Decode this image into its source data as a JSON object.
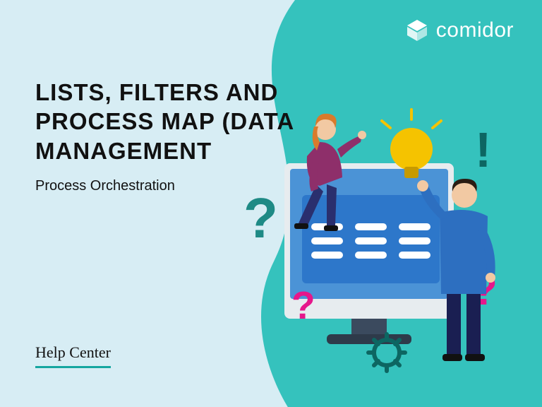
{
  "brand": {
    "name": "comidor"
  },
  "heading": "LISTS, FILTERS AND PROCESS MAP (DATA MANAGEMENT",
  "subtitle": "Process Orchestration",
  "help_center_label": "Help Center",
  "colors": {
    "bg_light": "#d7edf4",
    "teal_mid": "#3abfb9",
    "teal_dark": "#1e8a85",
    "magenta": "#e6178b",
    "yellow": "#f5c300",
    "accent_underline": "#15a6a0"
  }
}
